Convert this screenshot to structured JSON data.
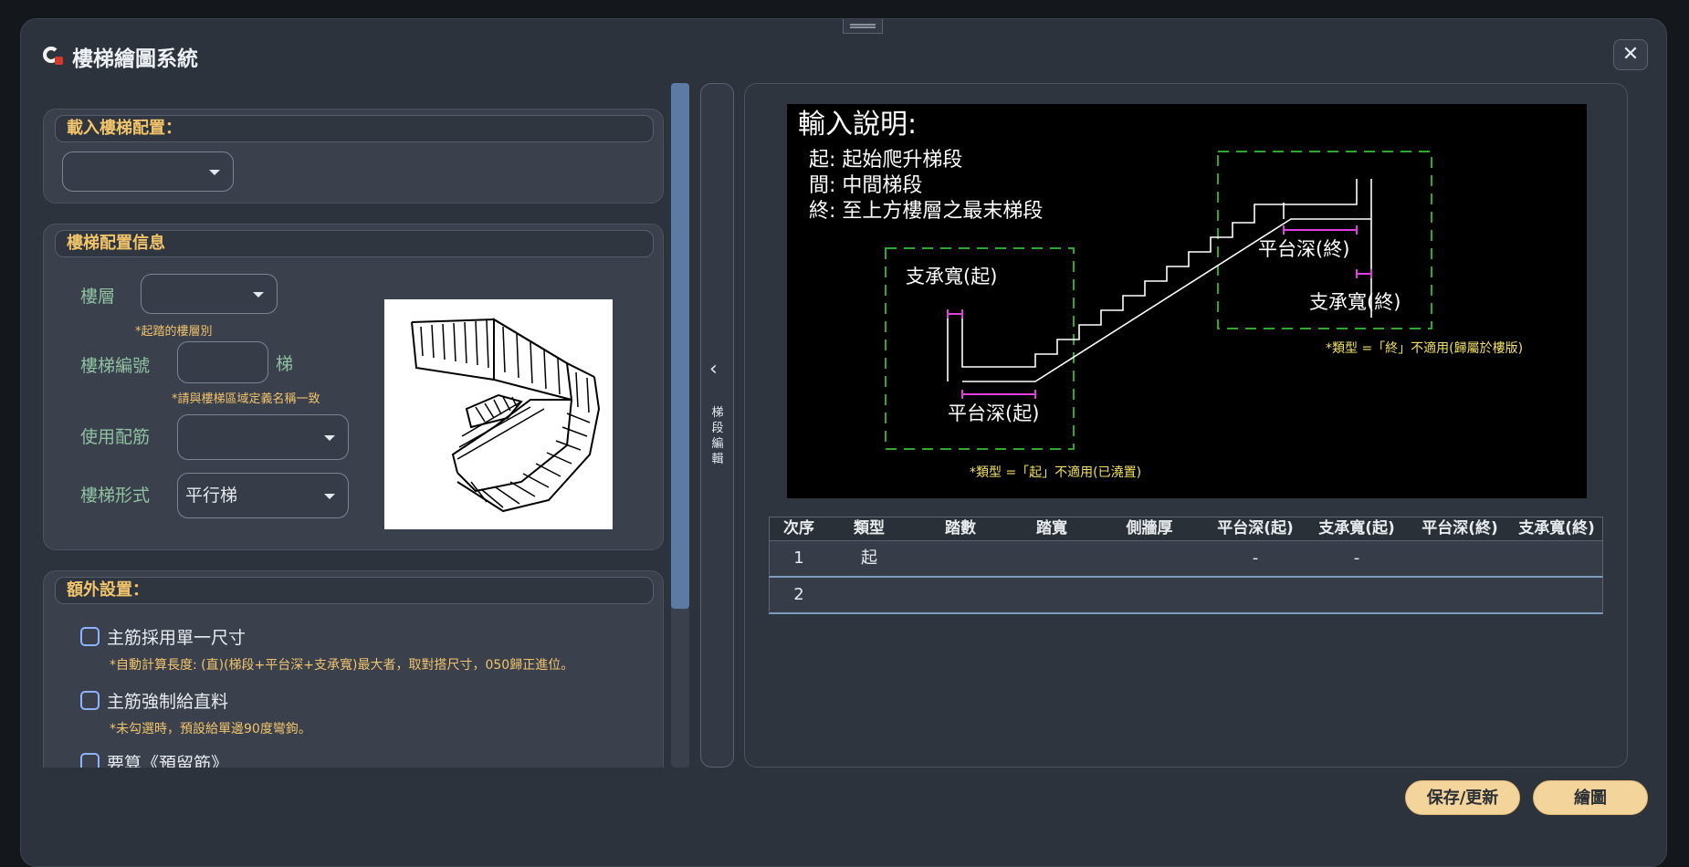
{
  "window": {
    "title": "樓梯繪圖系統",
    "close_label": "✕"
  },
  "load_config": {
    "header": "載入樓梯配置：",
    "dropdown_value": ""
  },
  "stair_info": {
    "header": "樓梯配置信息",
    "floor_label": "樓層",
    "floor_value": "",
    "floor_hint": "*起踏的樓層別",
    "stair_no_label": "樓梯編號",
    "stair_no_value": "",
    "stair_no_suffix": "梯",
    "stair_no_hint": "*請與樓梯區域定義名稱一致",
    "rebar_label": "使用配筋",
    "rebar_value": "",
    "form_label": "樓梯形式",
    "form_value": "平行梯"
  },
  "extra": {
    "header": "額外設置：",
    "options": [
      {
        "label": "主筋採用單一尺寸",
        "hint": "*自動計算長度: (直)(梯段+平台深+支承寬)最大者，取對搭尺寸，050歸正進位。",
        "checked": false
      },
      {
        "label": "主筋強制給直料",
        "hint": "*未勾選時，預設給單邊90度彎鉤。",
        "checked": false
      },
      {
        "label": "要算《預留筋》",
        "hint": "",
        "checked": false
      }
    ]
  },
  "side_tab": {
    "label": "梯段編輯"
  },
  "diagram": {
    "title": "輸入說明:",
    "legend": [
      "起: 起始爬升梯段",
      "間: 中間梯段",
      "終: 至上方樓層之最末梯段"
    ],
    "label_support_start": "支承寬(起)",
    "label_landing_start": "平台深(起)",
    "label_landing_end": "平台深(終)",
    "label_support_end": "支承寬(終)",
    "note_end": "*類型 =「終」不適用(歸屬於樓版)",
    "note_start": "*類型 =「起」不適用(已澆置)"
  },
  "table": {
    "headers": [
      "次序",
      "類型",
      "踏數",
      "踏寬",
      "側牆厚",
      "平台深(起)",
      "支承寬(起)",
      "平台深(終)",
      "支承寬(終)"
    ],
    "rows": [
      [
        "1",
        "起",
        "",
        "",
        "",
        "-",
        "-",
        "",
        ""
      ],
      [
        "2",
        "",
        "",
        "",
        "",
        "",
        "",
        "",
        ""
      ]
    ]
  },
  "buttons": {
    "save": "保存/更新",
    "draw": "繪圖"
  },
  "colors": {
    "accent": "#f1c36b",
    "label_green": "#8fc0a0",
    "button": "#f3d59b"
  }
}
